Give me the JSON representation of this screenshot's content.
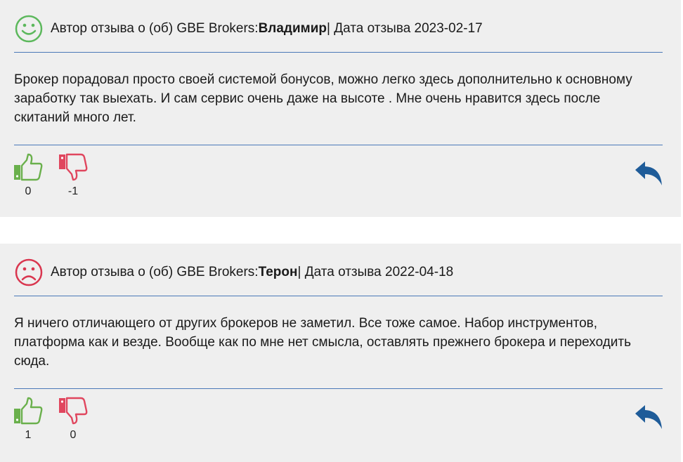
{
  "reviews": [
    {
      "mood": "happy",
      "mood_color": "#5cb85c",
      "prefix": "Автор отзыва о (об) GBE Brokers: ",
      "author": "Владимир",
      "date_text": " | Дата отзыва 2023-02-17",
      "text": "Брокер порадовал просто своей системой бонусов, можно легко здесь дополнительно к основному заработку так выехать. И сам сервис очень даже на высоте . Мне очень нравится здесь после скитаний много лет.",
      "likes": "0",
      "dislikes": "-1"
    },
    {
      "mood": "sad",
      "mood_color": "#d9364f",
      "prefix": "Автор отзыва о (об) GBE Brokers: ",
      "author": "Терон",
      "date_text": " | Дата отзыва 2022-04-18",
      "text": "Я ничего отличающего от других брокеров не заметил. Все тоже самое. Набор инструментов, платформа как и везде. Вообще как по мне нет смысла, оставлять прежнего брокера и переходить сюда.",
      "likes": "1",
      "dislikes": "0"
    }
  ],
  "icons": {
    "like": "thumbs-up-icon",
    "dislike": "thumbs-down-icon",
    "reply": "reply-arrow-icon"
  },
  "colors": {
    "like": "#6ab04c",
    "dislike": "#e0465e",
    "reply": "#1f5c99",
    "divider": "#4a78b8",
    "card_bg": "#efefef"
  }
}
